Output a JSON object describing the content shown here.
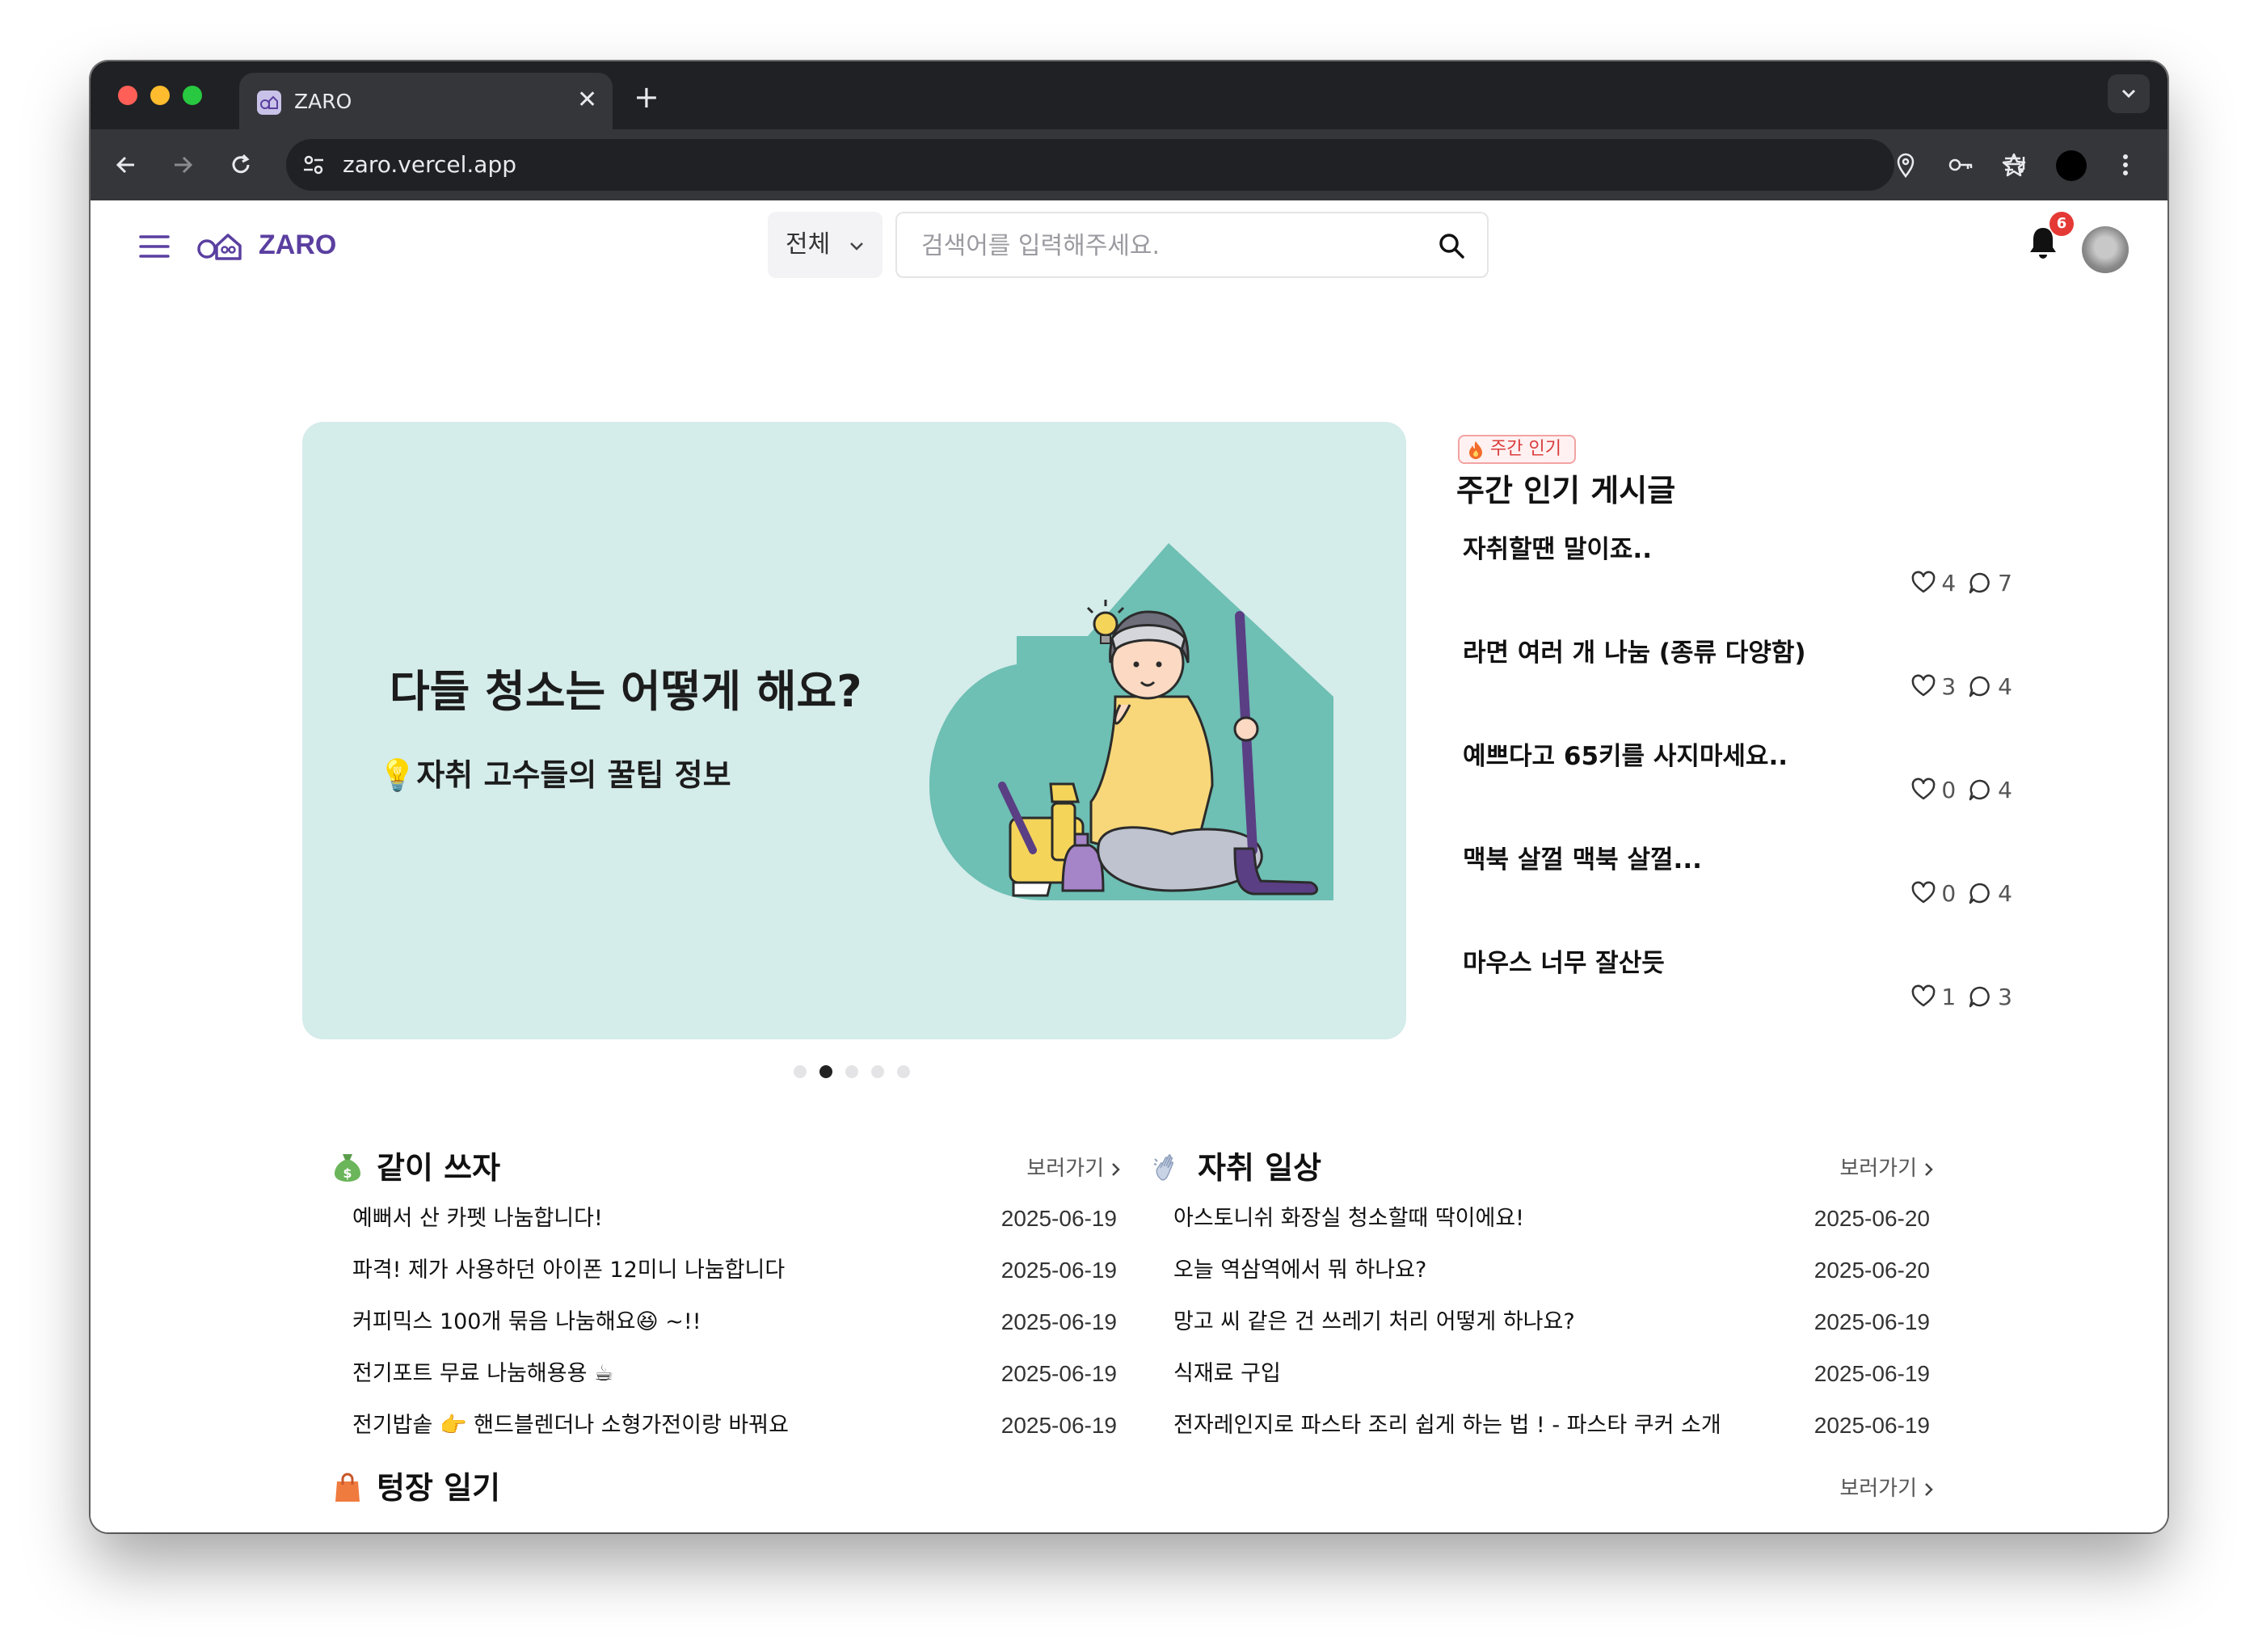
{
  "browser": {
    "tab_title": "ZARO",
    "tab_close": "✕",
    "new_tab": "+",
    "url": "zaro.vercel.app"
  },
  "header": {
    "brand": "ZARO",
    "category_selected": "전체",
    "search_placeholder": "검색어를 입력해주세요.",
    "notification_count": "6"
  },
  "banner": {
    "title": "다들 청소는 어떻게 해요?",
    "subtitle": "💡자취 고수들의 꿀팁 정보",
    "background": "#d4ecea",
    "slide_count": 5,
    "active_slide": 2
  },
  "popular": {
    "tag": "주간 인기",
    "heading": "주간 인기 게시글",
    "items": [
      {
        "title": "자취할땐 말이죠..",
        "likes": "4",
        "comments": "7"
      },
      {
        "title": "라면 여러 개 나눔 (종류 다양함)",
        "likes": "3",
        "comments": "4"
      },
      {
        "title": "예쁘다고 65키를 사지마세요..",
        "likes": "0",
        "comments": "4"
      },
      {
        "title": "맥북 살껄 맥북 살껄...",
        "likes": "0",
        "comments": "4"
      },
      {
        "title": "마우스 너무 잘산듯",
        "likes": "1",
        "comments": "3"
      }
    ]
  },
  "sections": {
    "share": {
      "title": "같이 쓰자",
      "more": "보러가기",
      "icon": "money-bag-icon",
      "rows": [
        {
          "title": "예뻐서 산 카펫 나눔합니다!",
          "date": "2025-06-19"
        },
        {
          "title": "파격! 제가 사용하던 아이폰 12미니 나눔합니다",
          "date": "2025-06-19"
        },
        {
          "title": "커피믹스 100개 묶음 나눔해요😆 ~!!",
          "date": "2025-06-19"
        },
        {
          "title": "전기포트 무료 나눔해용용 ☕",
          "date": "2025-06-19"
        },
        {
          "title": "전기밥솥 👉 핸드블렌더나 소형가전이랑 바꿔요",
          "date": "2025-06-19"
        }
      ]
    },
    "daily": {
      "title": "자취 일상",
      "more": "보러가기",
      "icon": "waving-hand-icon",
      "rows": [
        {
          "title": "아스토니쉬 화장실 청소할때 딱이에요!",
          "date": "2025-06-20"
        },
        {
          "title": "오늘 역삼역에서 뭐 하나요?",
          "date": "2025-06-20"
        },
        {
          "title": "망고 씨 같은 건 쓰레기 처리 어떻게 하나요?",
          "date": "2025-06-19"
        },
        {
          "title": "식재료 구입",
          "date": "2025-06-19"
        },
        {
          "title": "전자레인지로 파스타 조리 쉽게 하는 법 ! - 파스타 쿠커 소개",
          "date": "2025-06-19"
        }
      ]
    },
    "haul": {
      "title": "텅장 일기",
      "more": "보러가기",
      "icon": "shopping-bag-icon"
    }
  },
  "colors": {
    "brand": "#5a3fa0",
    "badge": "#e53935",
    "popular_tag": "#d93c3c"
  }
}
